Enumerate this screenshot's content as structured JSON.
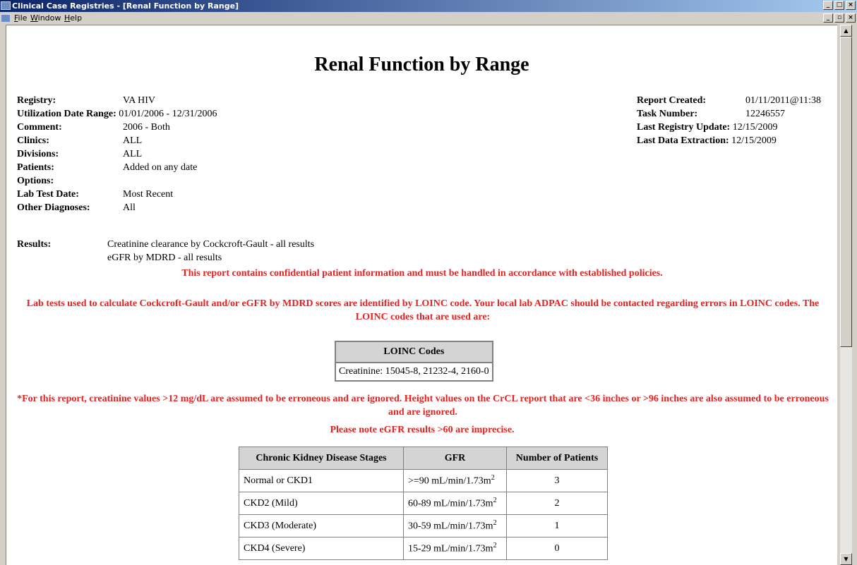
{
  "window": {
    "title": "Clinical Case Registries - [Renal Function by Range]"
  },
  "menu": [
    {
      "label": "File",
      "u": "F",
      "rest": "ile"
    },
    {
      "label": "Window",
      "u": "W",
      "rest": "indow"
    },
    {
      "label": "Help",
      "u": "H",
      "rest": "elp"
    }
  ],
  "report": {
    "title": "Renal Function by Range",
    "left": [
      {
        "label": "Registry:",
        "value": "VA HIV"
      },
      {
        "label": "Utilization Date Range:",
        "value": "01/01/2006 - 12/31/2006"
      },
      {
        "label": "Comment:",
        "value": "2006 - Both"
      },
      {
        "label": "Clinics:",
        "value": "ALL"
      },
      {
        "label": "Divisions:",
        "value": "ALL"
      },
      {
        "label": "Patients:",
        "value": "Added on any date"
      },
      {
        "label": "Options:",
        "value": ""
      },
      {
        "label": "Lab Test Date:",
        "value": "Most Recent"
      },
      {
        "label": "Other Diagnoses:",
        "value": "All"
      }
    ],
    "right": [
      {
        "label": "Report Created:",
        "value": "01/11/2011@11:38"
      },
      {
        "label": "Task Number:",
        "value": "12246557"
      },
      {
        "label": "Last Registry Update:",
        "value": "12/15/2009"
      },
      {
        "label": "Last Data Extraction:",
        "value": "12/15/2009"
      }
    ],
    "results_label": "Results:",
    "results": [
      "Creatinine clearance by Cockcroft-Gault - all results",
      "eGFR by MDRD - all results"
    ],
    "confidential": "This report contains confidential patient information and must be handled in accordance with established policies.",
    "loinc_note": "Lab tests used to calculate Cockcroft-Gault and/or eGFR by MDRD scores are identified by LOINC code. Your local lab ADPAC should be contacted regarding errors in LOINC codes. The LOINC codes that are used are:",
    "loinc_header": "LOINC Codes",
    "loinc_value": "Creatinine: 15045-8, 21232-4, 2160-0",
    "erroneous_note": "*For this report, creatinine values >12 mg/dL are assumed to be erroneous and are ignored. Height values on the CrCL report that are <36 inches or >96 inches are also assumed to be erroneous and are ignored.",
    "egfr_note": "Please note eGFR results >60 are imprecise.",
    "ckd_headers": [
      "Chronic Kidney Disease Stages",
      "GFR",
      "Number of Patients"
    ],
    "gfr_unit": "mL/min/1.73m",
    "gfr_sup": "2",
    "ckd_rows": [
      {
        "stage": "Normal or CKD1",
        "gfr": ">=90",
        "count": "3"
      },
      {
        "stage": "CKD2 (Mild)",
        "gfr": "60-89",
        "count": "2"
      },
      {
        "stage": "CKD3 (Moderate)",
        "gfr": "30-59",
        "count": "1"
      },
      {
        "stage": "CKD4 (Severe)",
        "gfr": "15-29",
        "count": "0"
      }
    ]
  }
}
